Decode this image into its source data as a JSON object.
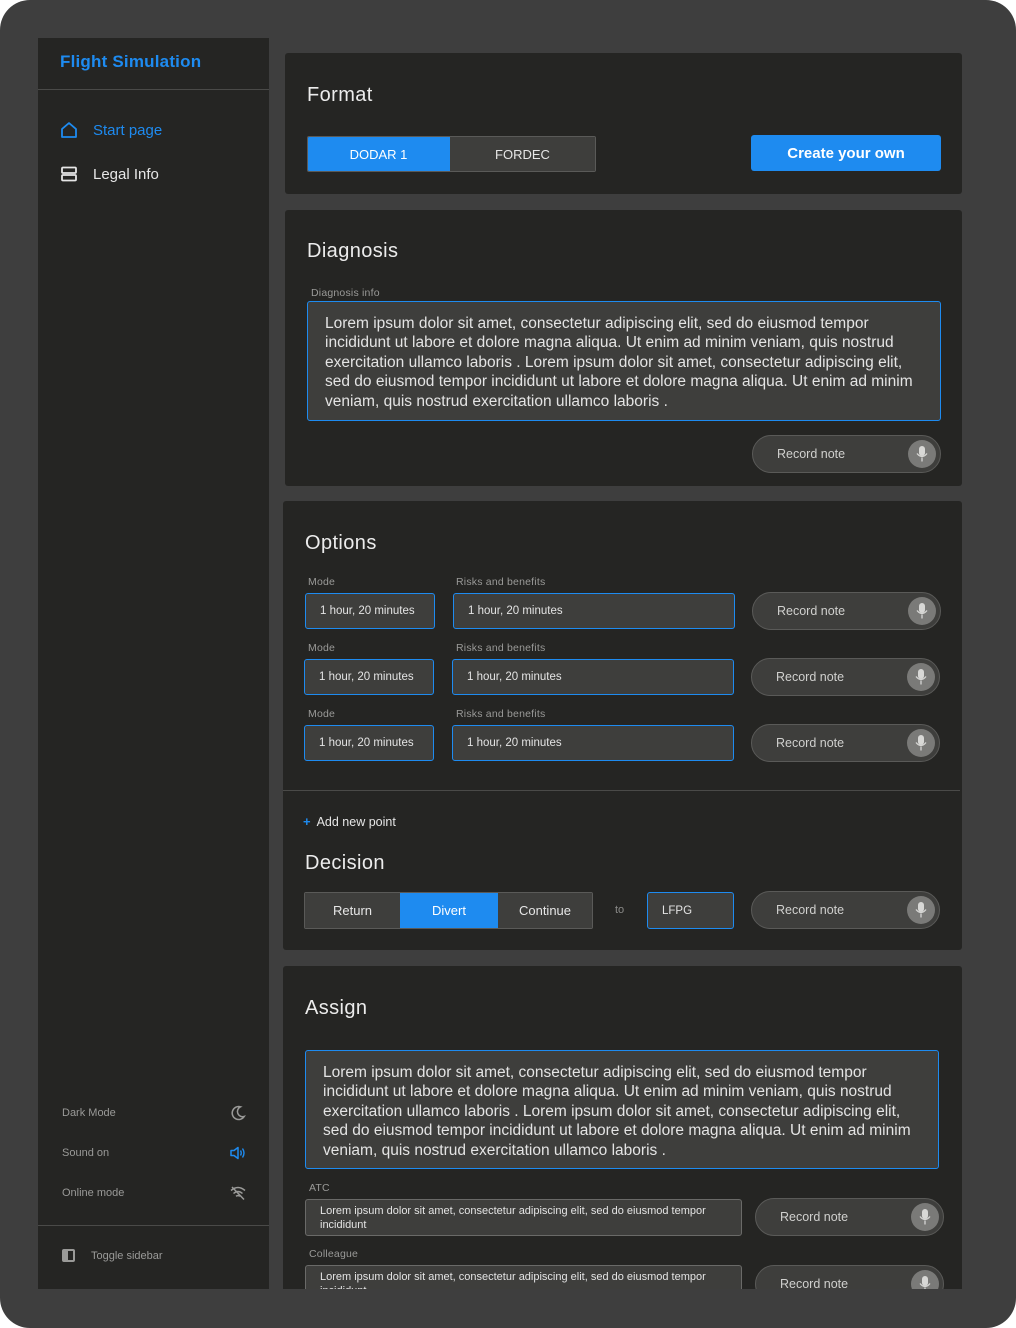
{
  "sidebar": {
    "brand": "Flight Simulation",
    "nav": [
      {
        "label": "Start page",
        "icon": "home-icon"
      },
      {
        "label": "Legal Info",
        "icon": "list-icon"
      }
    ],
    "settings": [
      {
        "label": "Dark Mode",
        "icon": "moon-icon"
      },
      {
        "label": "Sound on",
        "icon": "speaker-icon"
      },
      {
        "label": "Online mode",
        "icon": "wifi-off-icon"
      }
    ],
    "toggle_label": "Toggle sidebar"
  },
  "format": {
    "title": "Format",
    "options": [
      "DODAR 1",
      "FORDEC"
    ],
    "selected": "DODAR 1",
    "create_label": "Create your own"
  },
  "diagnosis": {
    "title": "Diagnosis",
    "field_label": "Diagnosis info",
    "text": "Lorem ipsum dolor sit amet, consectetur adipiscing elit, sed do eiusmod tempor incididunt ut labore et dolore magna aliqua. Ut enim ad minim veniam, quis nostrud exercitation ullamco laboris . Lorem ipsum dolor sit amet, consectetur adipiscing elit, sed do eiusmod tempor incididunt ut labore et dolore magna aliqua. Ut enim ad minim veniam, quis nostrud exercitation ullamco laboris .",
    "record_label": "Record note"
  },
  "options": {
    "title": "Options",
    "rows": [
      {
        "mode_label": "Mode",
        "mode_value": "1 hour, 20 minutes",
        "risk_label": "Risks and benefits",
        "risk_value": "1 hour, 20 minutes",
        "record_label": "Record note"
      },
      {
        "mode_label": "Mode",
        "mode_value": "1 hour, 20 minutes",
        "risk_label": "Risks and benefits",
        "risk_value": "1 hour, 20 minutes",
        "record_label": "Record note"
      },
      {
        "mode_label": "Mode",
        "mode_value": "1 hour, 20 minutes",
        "risk_label": "Risks and benefits",
        "risk_value": "1 hour, 20 minutes",
        "record_label": "Record note"
      }
    ],
    "add_label": "Add new point"
  },
  "decision": {
    "title": "Decision",
    "choices": [
      "Return",
      "Divert",
      "Continue"
    ],
    "selected": "Divert",
    "to_label": "to",
    "destination": "LFPG",
    "record_label": "Record note"
  },
  "assign": {
    "title": "Assign",
    "text": "Lorem ipsum dolor sit amet, consectetur adipiscing elit, sed do eiusmod tempor incididunt ut labore et dolore magna aliqua. Ut enim ad minim veniam, quis nostrud exercitation ullamco laboris . Lorem ipsum dolor sit amet, consectetur adipiscing elit, sed do eiusmod tempor incididunt ut labore et dolore magna aliqua. Ut enim ad minim veniam, quis nostrud exercitation ullamco laboris .",
    "atc_label": "ATC",
    "atc_text": "Lorem ipsum dolor sit amet, consectetur adipiscing elit, sed do eiusmod tempor incididunt",
    "colleague_label": "Colleague",
    "colleague_text": "Lorem ipsum dolor sit amet, consectetur adipiscing elit, sed do eiusmod tempor incididunt",
    "record_label": "Record note"
  },
  "colors": {
    "accent": "#1e8bf0",
    "card": "#252523",
    "frame": "#3e3e3e"
  }
}
